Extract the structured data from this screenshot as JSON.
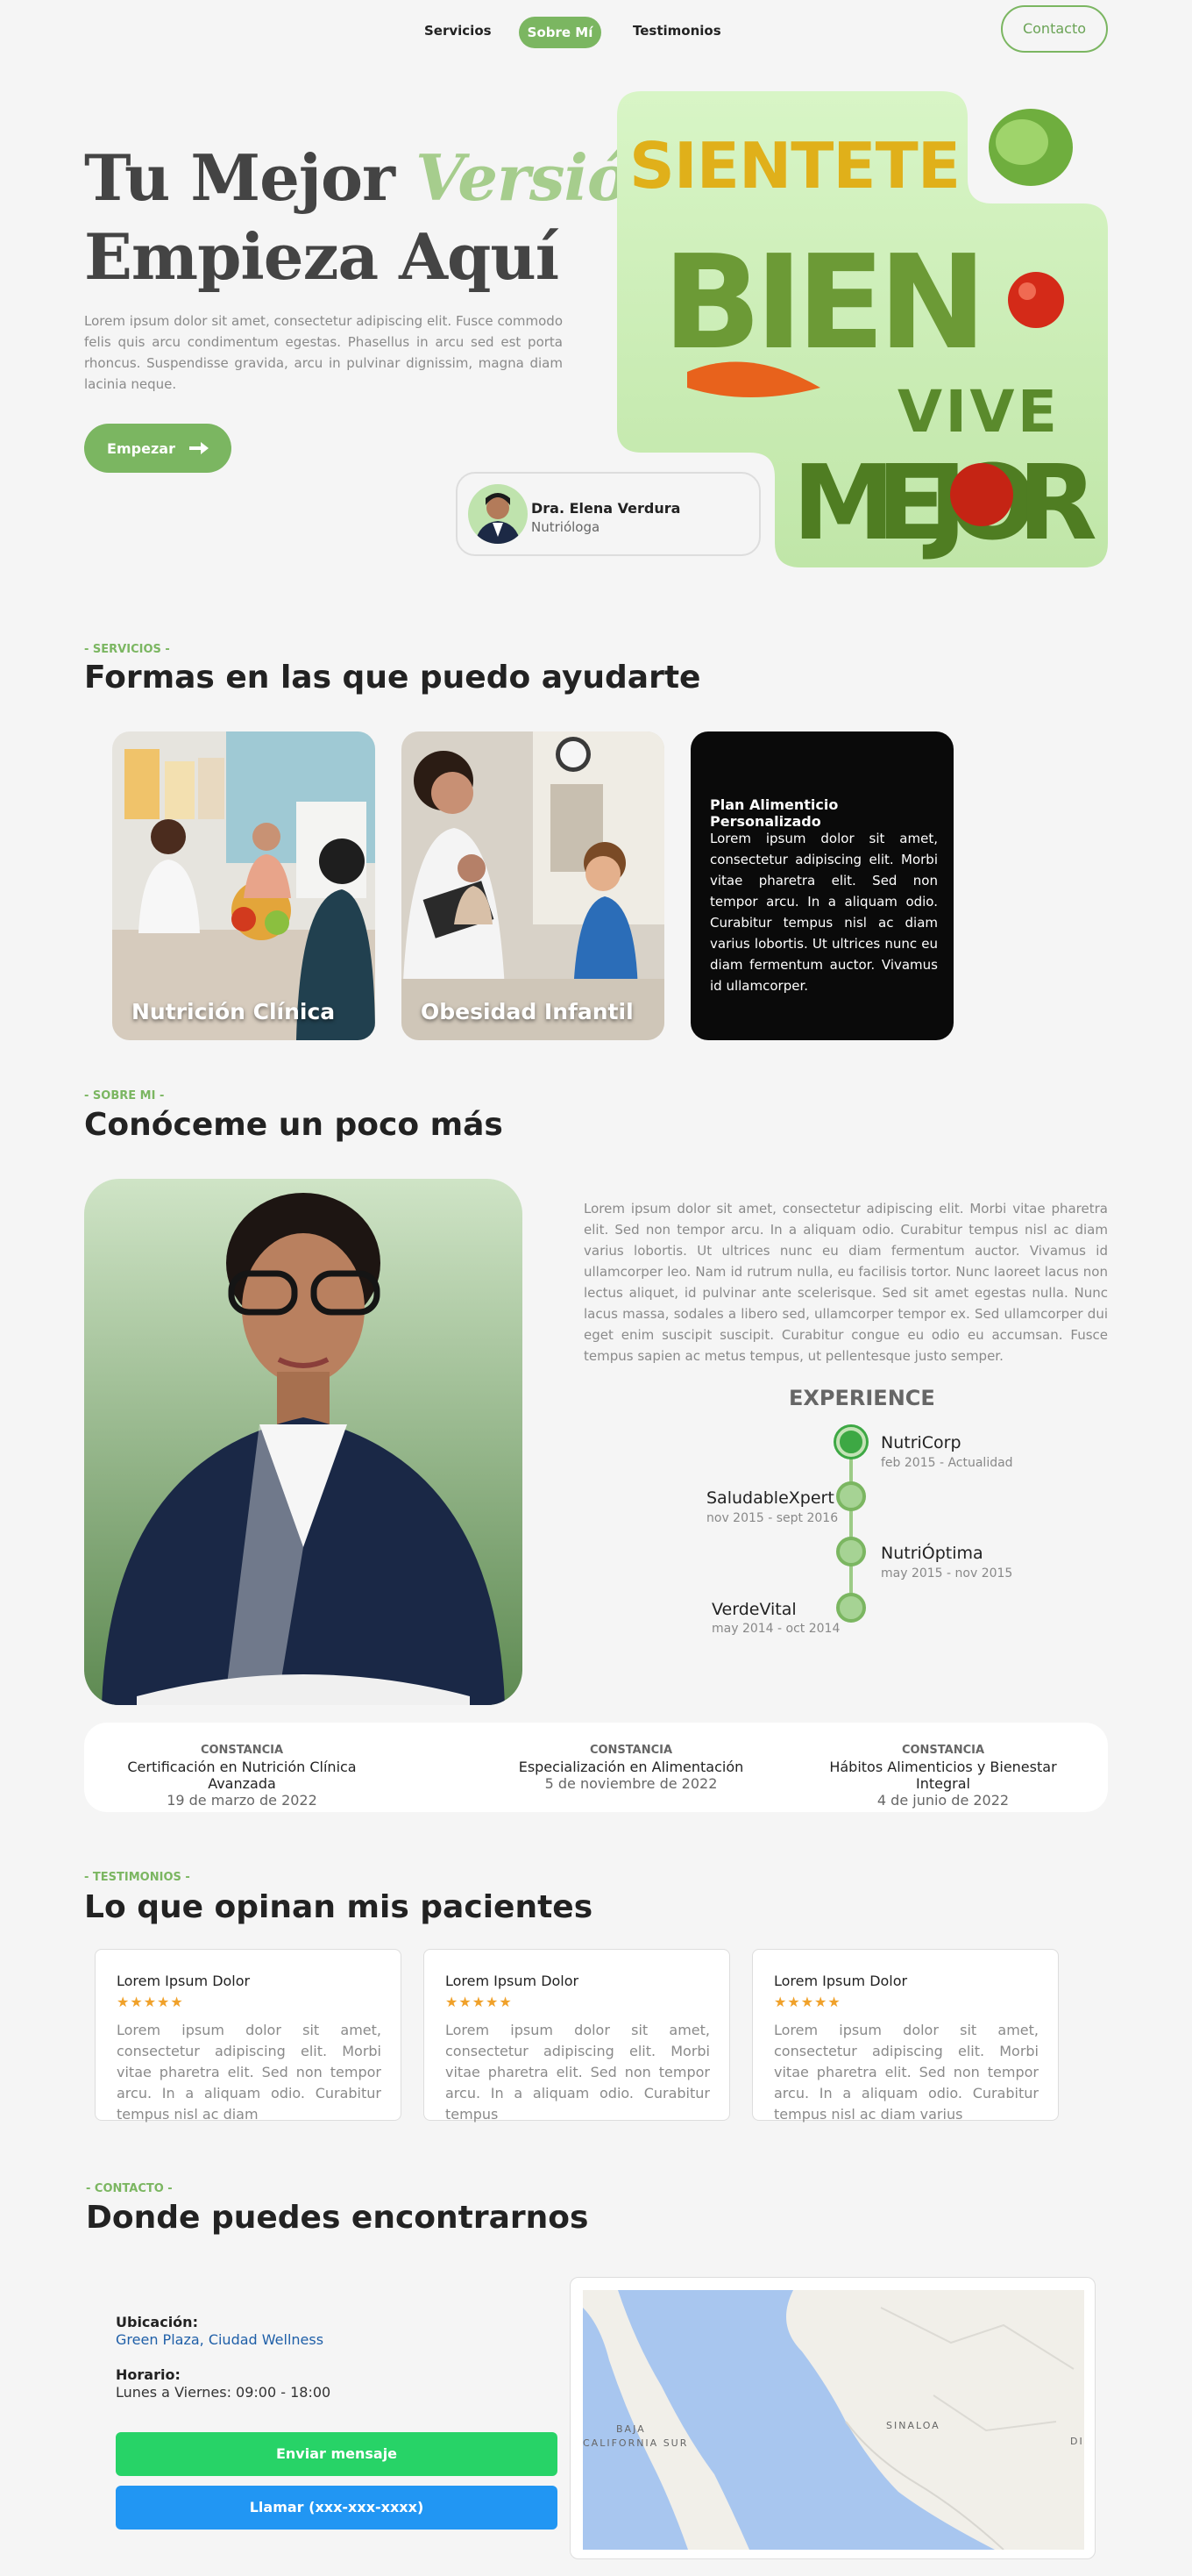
{
  "nav": {
    "links": [
      "Servicios",
      "Sobre Mí",
      "Testimonios"
    ],
    "contact_label": "Contacto"
  },
  "hero": {
    "title_line1": "Tu Mejor",
    "title_accent": "Versión",
    "title_line2": "Empieza Aquí",
    "paragraph": "Lorem ipsum dolor sit amet, consectetur adipiscing elit. Fusce commodo felis quis arcu condimentum egestas. Phasellus in arcu sed est porta rhoncus. Suspendisse gravida, arcu in pulvinar dignissim, magna diam lacinia neque.",
    "button_label": "Empezar",
    "image_words": [
      "SIENTETE",
      "BIEN",
      "VIVE",
      "MEJOR"
    ],
    "doctor": {
      "name": "Dra. Elena Verdura",
      "role": "Nutrióloga"
    }
  },
  "services": {
    "tag": "- SERVICIOS -",
    "title": "Formas en las que puedo ayudarte",
    "cards": [
      {
        "label": "Nutrición Clínica"
      },
      {
        "label": "Obesidad Infantil"
      },
      {
        "title": "Plan Alimenticio Personalizado",
        "text": "Lorem ipsum dolor sit amet, consectetur adipiscing elit. Morbi vitae pharetra elit. Sed non tempor arcu. In a aliquam odio. Curabitur tempus nisl ac diam varius lobortis. Ut ultrices nunc eu diam fermentum auctor. Vivamus id ullamcorper."
      }
    ]
  },
  "about": {
    "tag": "- SOBRE MI -",
    "title": "Conóceme un poco más",
    "paragraph": "Lorem ipsum dolor sit amet, consectetur adipiscing elit. Morbi vitae pharetra elit. Sed non tempor arcu. In a aliquam odio. Curabitur tempus nisl ac diam varius lobortis. Ut ultrices nunc eu diam fermentum auctor. Vivamus id ullamcorper leo. Nam id rutrum nulla, eu facilisis tortor. Nunc laoreet lacus non lectus aliquet, id pulvinar ante scelerisque. Sed sit amet egestas nulla. Nunc lacus massa, sodales a libero sed, ullamcorper tempor ex. Sed ullamcorper dui eget enim suscipit suscipit. Curabitur congue eu odio eu accumsan. Fusce tempus sapien ac metus tempus, ut pellentesque justo semper.",
    "experience_title": "EXPERIENCE",
    "experience": [
      {
        "company": "NutriCorp",
        "dates": "feb 2015 - Actualidad"
      },
      {
        "company": "SaludableXpert",
        "dates": "nov 2015 - sept 2016"
      },
      {
        "company": "NutriÓptima",
        "dates": "may 2015 - nov 2015"
      },
      {
        "company": "VerdeVital",
        "dates": "may 2014 - oct 2014"
      }
    ],
    "certificates": [
      {
        "kind": "CONSTANCIA",
        "name": "Certificación en Nutrición Clínica Avanzada",
        "date": "19 de marzo de 2022"
      },
      {
        "kind": "CONSTANCIA",
        "name": "Especialización en Alimentación",
        "date": "5 de noviembre de 2022"
      },
      {
        "kind": "CONSTANCIA",
        "name": "Hábitos Alimenticios y Bienestar Integral",
        "date": "4 de junio de 2022"
      }
    ]
  },
  "testimonials": {
    "tag": "- TESTIMONIOS -",
    "title": "Lo que opinan mis pacientes",
    "items": [
      {
        "name": "Lorem Ipsum Dolor",
        "stars": "★★★★★",
        "text": "Lorem ipsum dolor sit amet, consectetur adipiscing elit. Morbi vitae pharetra elit. Sed non tempor arcu. In a aliquam odio. Curabitur tempus nisl ac diam"
      },
      {
        "name": "Lorem Ipsum Dolor",
        "stars": "★★★★★",
        "text": "Lorem ipsum dolor sit amet, consectetur adipiscing elit. Morbi vitae pharetra elit. Sed non tempor arcu. In a aliquam odio. Curabitur tempus"
      },
      {
        "name": "Lorem Ipsum Dolor",
        "stars": "★★★★★",
        "text": "Lorem ipsum dolor sit amet, consectetur adipiscing elit. Morbi vitae pharetra elit. Sed non tempor arcu. In a aliquam odio. Curabitur tempus nisl ac diam varius"
      }
    ]
  },
  "contact": {
    "tag": "- CONTACTO -",
    "title": "Donde puedes encontrarnos",
    "location_label": "Ubicación:",
    "location_value": "Green Plaza, Ciudad Wellness",
    "hours_label": "Horario:",
    "hours_value": "Lunes a Viernes: 09:00 - 18:00",
    "message_button": "Enviar mensaje",
    "call_button": "Llamar (xxx-xxx-xxxx)",
    "map_labels": [
      "BAJA",
      "CALIFORNIA SUR",
      "SINALOA",
      "DI"
    ]
  },
  "colors": {
    "accent": "#7bb661",
    "accent_light": "#a6cd8d",
    "whatsapp": "#27d367",
    "call": "#2196f3",
    "stars": "#f0a12a"
  }
}
